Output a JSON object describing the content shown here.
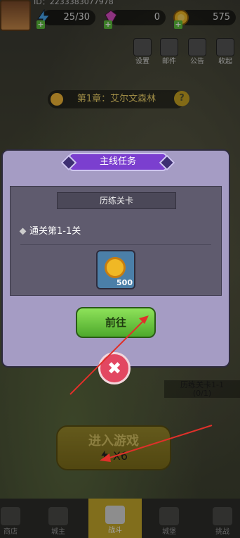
{
  "topbar": {
    "uid": "ID：2233383077978",
    "energy": "25/30",
    "gems": "0",
    "gold": "575"
  },
  "mini_buttons": [
    "设置",
    "邮件",
    "公告",
    "收起"
  ],
  "chapter": {
    "label": "第1章：艾尔文森林",
    "help": "?"
  },
  "stage_tag": {
    "line1": "历练关卡1-1",
    "line2": "(0/1)"
  },
  "enter_game": {
    "title": "进入游戏",
    "cost": "X6"
  },
  "bottom_nav": [
    "商店",
    "城主",
    "战斗",
    "城堡",
    "挑战"
  ],
  "modal": {
    "title": "主线任务",
    "subtitle": "历练关卡",
    "quest": "通关第1-1关",
    "reward_amount": "500",
    "go_label": "前往",
    "close": "✖"
  }
}
